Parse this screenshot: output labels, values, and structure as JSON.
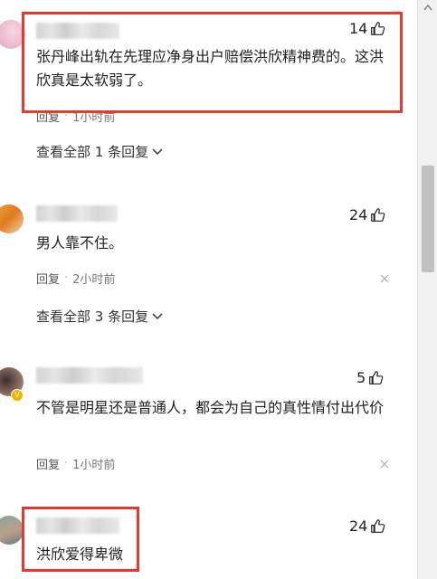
{
  "comments": [
    {
      "likes": "14",
      "content": "张丹峰出轨在先理应净身出户赔偿洪欣精神费的。这洪欣真是太软弱了。",
      "reply_label": "回复",
      "time": "1小时前",
      "view_all": "查看全部 1 条回复"
    },
    {
      "likes": "24",
      "content": "男人靠不住。",
      "reply_label": "回复",
      "time": "2小时前",
      "view_all": "查看全部 3 条回复"
    },
    {
      "likes": "5",
      "content": "不管是明星还是普通人，都会为自己的真性情付出代价",
      "reply_label": "回复",
      "time": "1小时前"
    },
    {
      "likes": "24",
      "content": "洪欣爱得卑微"
    }
  ],
  "colors": {
    "highlight": "#e8392f",
    "badge": "#f5b400"
  }
}
